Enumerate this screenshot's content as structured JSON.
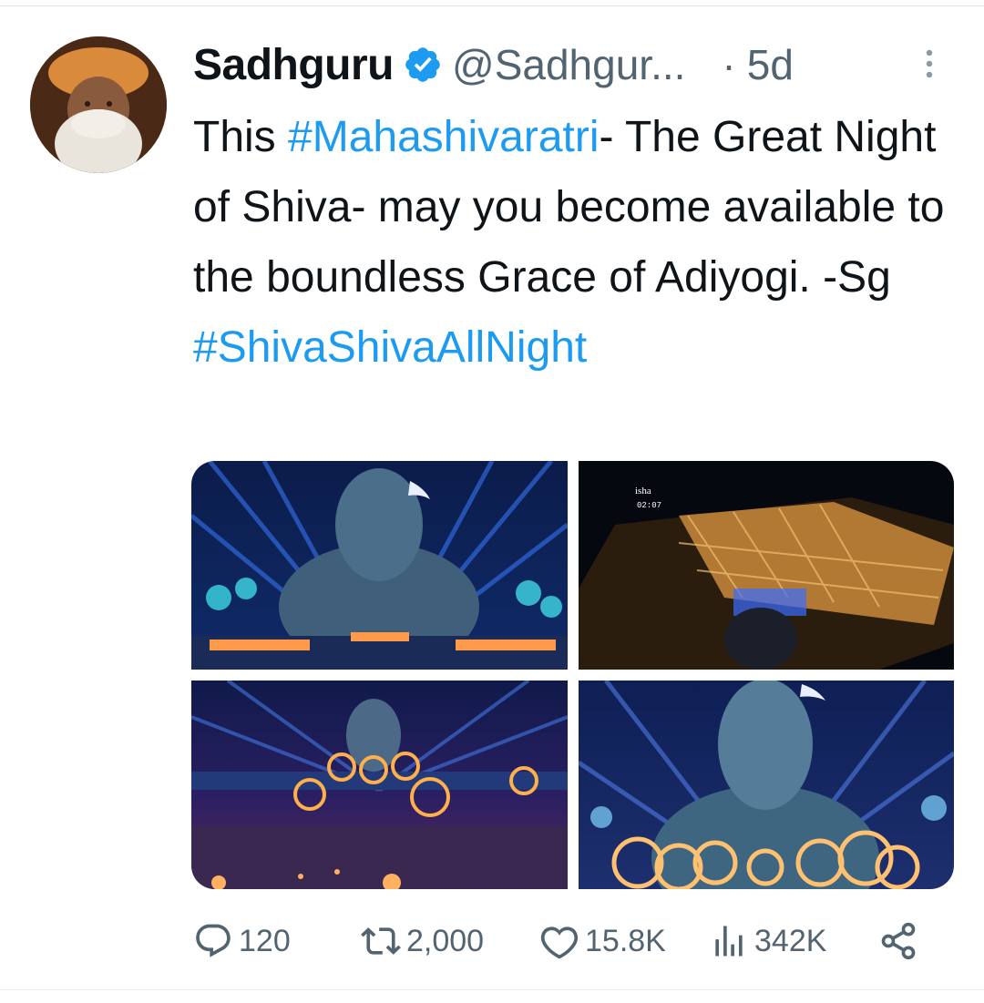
{
  "tweet": {
    "author_name": "Sadhguru",
    "handle": "@Sadhgur...",
    "separator": "·",
    "time": "5d",
    "text_before_tag": "This ",
    "hashtag_1": "#Mahashivaratri",
    "text_after_tag": "- The Great Night of Shiva- may you become available to the boundless Grace of Adiyogi. -Sg",
    "hashtag_2": "#ShivaShivaAllNight",
    "icons": {
      "verified": "verified-badge-icon",
      "more": "more-options-icon",
      "reply": "reply-icon",
      "retweet": "retweet-icon",
      "like": "like-icon",
      "views": "views-icon",
      "share": "share-icon"
    },
    "media_overlay_text": "02:07",
    "media_logo_text": "isha"
  },
  "stats": {
    "replies": "120",
    "retweets": "2,000",
    "likes": "15.8K",
    "views": "342K"
  },
  "colors": {
    "link": "#1d9bf0",
    "secondary_text": "#536471",
    "primary_text": "#0f1419",
    "verified": "#1d9bf0"
  }
}
